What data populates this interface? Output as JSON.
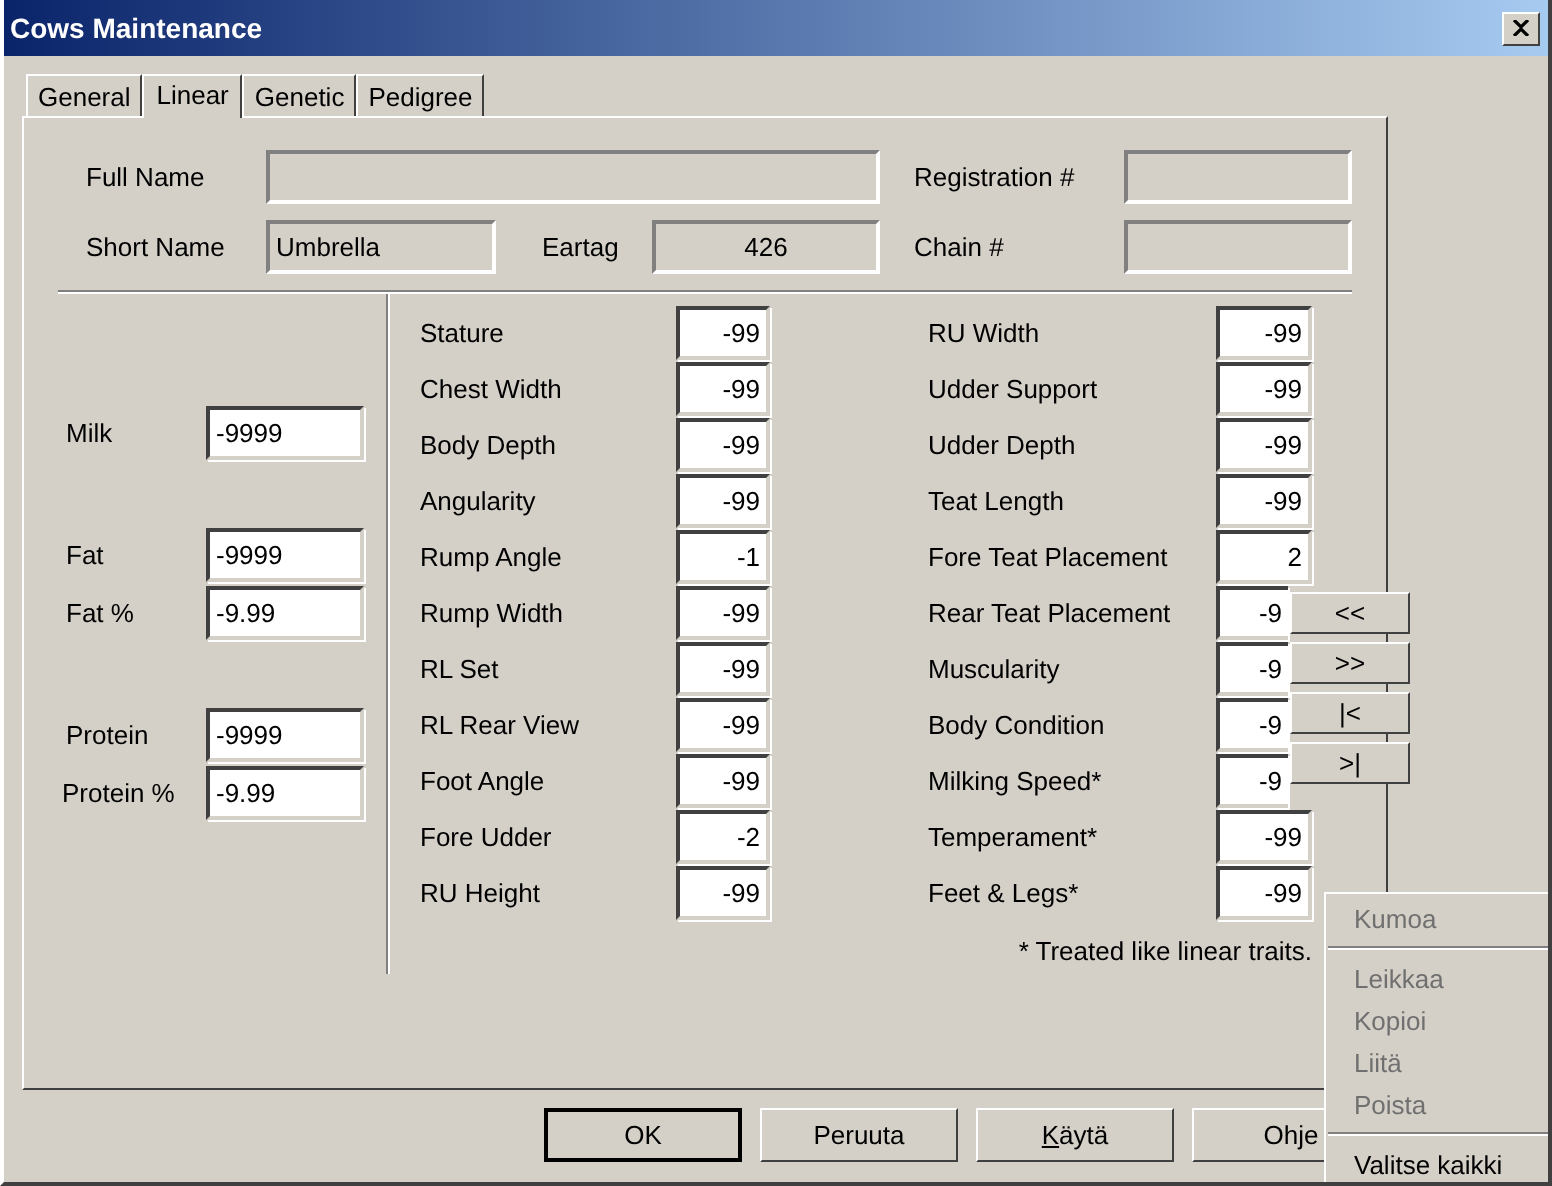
{
  "window": {
    "title": "Cows Maintenance"
  },
  "tabs": [
    {
      "label": "General",
      "selected": false
    },
    {
      "label": "Linear",
      "selected": true
    },
    {
      "label": "Genetic",
      "selected": false
    },
    {
      "label": "Pedigree",
      "selected": false
    }
  ],
  "identity": {
    "full_name": {
      "label": "Full Name"
    },
    "registration": {
      "label": "Registration #"
    },
    "short_name": {
      "label": "Short Name",
      "value": "Umbrella"
    },
    "eartag": {
      "label": "Eartag",
      "value": "426"
    },
    "chain": {
      "label": "Chain #"
    }
  },
  "production_groups": [
    {
      "fields": [
        {
          "label": "Milk",
          "value": "-9999"
        }
      ]
    },
    {
      "fields": [
        {
          "label": "Fat",
          "value": "-9999"
        },
        {
          "label": "Fat %",
          "value": "-9.99"
        }
      ]
    },
    {
      "fields": [
        {
          "label": "Protein",
          "value": "-9999"
        },
        {
          "label": "Protein %",
          "value": "-9.99"
        }
      ]
    }
  ],
  "traits_left": [
    {
      "label": "Stature",
      "value": "-99"
    },
    {
      "label": "Chest Width",
      "value": "-99"
    },
    {
      "label": "Body Depth",
      "value": "-99"
    },
    {
      "label": "Angularity",
      "value": "-99"
    },
    {
      "label": "Rump Angle",
      "value": "-1"
    },
    {
      "label": "Rump Width",
      "value": "-99"
    },
    {
      "label": "RL Set",
      "value": "-99"
    },
    {
      "label": "RL Rear View",
      "value": "-99"
    },
    {
      "label": "Foot Angle",
      "value": "-99"
    },
    {
      "label": "Fore Udder",
      "value": "-2"
    },
    {
      "label": "RU Height",
      "value": "-99"
    }
  ],
  "traits_right": [
    {
      "label": "RU Width",
      "value": "-99"
    },
    {
      "label": "Udder Support",
      "value": "-99"
    },
    {
      "label": "Udder Depth",
      "value": "-99"
    },
    {
      "label": "Teat Length",
      "value": "-99"
    },
    {
      "label": "Fore Teat Placement",
      "value": "2"
    },
    {
      "label": "Rear Teat Placement",
      "value": "-9"
    },
    {
      "label": "Muscularity",
      "value": "-9"
    },
    {
      "label": "Body Condition",
      "value": "-9"
    },
    {
      "label": "Milking Speed*",
      "value": "-9"
    },
    {
      "label": "Temperament*",
      "value": "-99"
    },
    {
      "label": "Feet & Legs*",
      "value": "-99"
    }
  ],
  "footnote": "* Treated like linear traits.",
  "nav_buttons": [
    "<<",
    ">>",
    "|<",
    ">|"
  ],
  "buttons": [
    {
      "label": "OK",
      "default": true,
      "underline_first": false
    },
    {
      "label": "Peruuta",
      "default": false,
      "underline_first": false
    },
    {
      "label": "Käytä",
      "default": false,
      "underline_first": true
    },
    {
      "label": "Ohje",
      "default": false,
      "underline_first": false
    }
  ],
  "context_menu": [
    {
      "kind": "item",
      "label": "Kumoa",
      "disabled": true
    },
    {
      "kind": "separator"
    },
    {
      "kind": "item",
      "label": "Leikkaa",
      "disabled": true
    },
    {
      "kind": "item",
      "label": "Kopioi",
      "disabled": true
    },
    {
      "kind": "item",
      "label": "Liitä",
      "disabled": true
    },
    {
      "kind": "item",
      "label": "Poista",
      "disabled": true
    },
    {
      "kind": "separator"
    },
    {
      "kind": "item",
      "label": "Valitse kaikki",
      "disabled": false
    }
  ]
}
